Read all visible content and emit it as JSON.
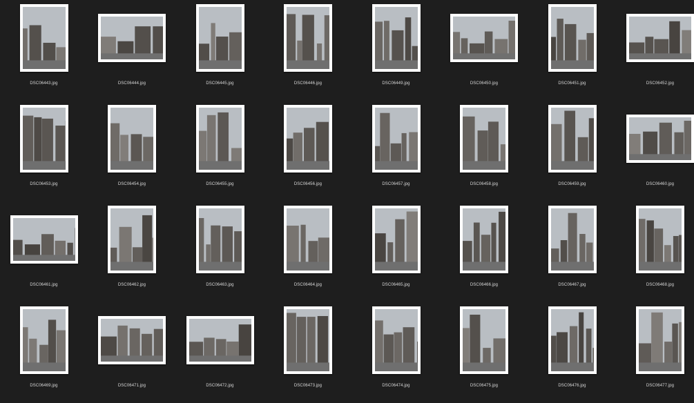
{
  "files": [
    {
      "name": "DSC06443.jpg",
      "orientation": "portrait"
    },
    {
      "name": "DSC06444.jpg",
      "orientation": "landscape"
    },
    {
      "name": "DSC06445.jpg",
      "orientation": "portrait"
    },
    {
      "name": "DSC06446.jpg",
      "orientation": "portrait"
    },
    {
      "name": "DSC06449.jpg",
      "orientation": "portrait"
    },
    {
      "name": "DSC06450.jpg",
      "orientation": "landscape"
    },
    {
      "name": "DSC06451.jpg",
      "orientation": "portrait"
    },
    {
      "name": "DSC06452.jpg",
      "orientation": "landscape"
    },
    {
      "name": "DSC06453.jpg",
      "orientation": "portrait"
    },
    {
      "name": "DSC06454.jpg",
      "orientation": "portrait"
    },
    {
      "name": "DSC06455.jpg",
      "orientation": "portrait"
    },
    {
      "name": "DSC06456.jpg",
      "orientation": "portrait"
    },
    {
      "name": "DSC06457.jpg",
      "orientation": "portrait"
    },
    {
      "name": "DSC06458.jpg",
      "orientation": "portrait"
    },
    {
      "name": "DSC06459.jpg",
      "orientation": "portrait"
    },
    {
      "name": "DSC06460.jpg",
      "orientation": "landscape"
    },
    {
      "name": "DSC06461.jpg",
      "orientation": "landscape"
    },
    {
      "name": "DSC06462.jpg",
      "orientation": "portrait"
    },
    {
      "name": "DSC06463.jpg",
      "orientation": "portrait"
    },
    {
      "name": "DSC06464.jpg",
      "orientation": "portrait"
    },
    {
      "name": "DSC06465.jpg",
      "orientation": "portrait"
    },
    {
      "name": "DSC06466.jpg",
      "orientation": "portrait"
    },
    {
      "name": "DSC06467.jpg",
      "orientation": "portrait"
    },
    {
      "name": "DSC06468.jpg",
      "orientation": "portrait"
    },
    {
      "name": "DSC06469.jpg",
      "orientation": "portrait"
    },
    {
      "name": "DSC06471.jpg",
      "orientation": "landscape"
    },
    {
      "name": "DSC06472.jpg",
      "orientation": "landscape"
    },
    {
      "name": "DSC06473.jpg",
      "orientation": "portrait"
    },
    {
      "name": "DSC06474.jpg",
      "orientation": "portrait"
    },
    {
      "name": "DSC06475.jpg",
      "orientation": "portrait"
    },
    {
      "name": "DSC06476.jpg",
      "orientation": "portrait"
    },
    {
      "name": "DSC06477.jpg",
      "orientation": "portrait"
    }
  ],
  "colors": {
    "background": "#1e1e1e",
    "frame": "#ffffff",
    "label": "#d9d9d9",
    "sky": "#b9bec3",
    "building": "#5c5a57"
  }
}
